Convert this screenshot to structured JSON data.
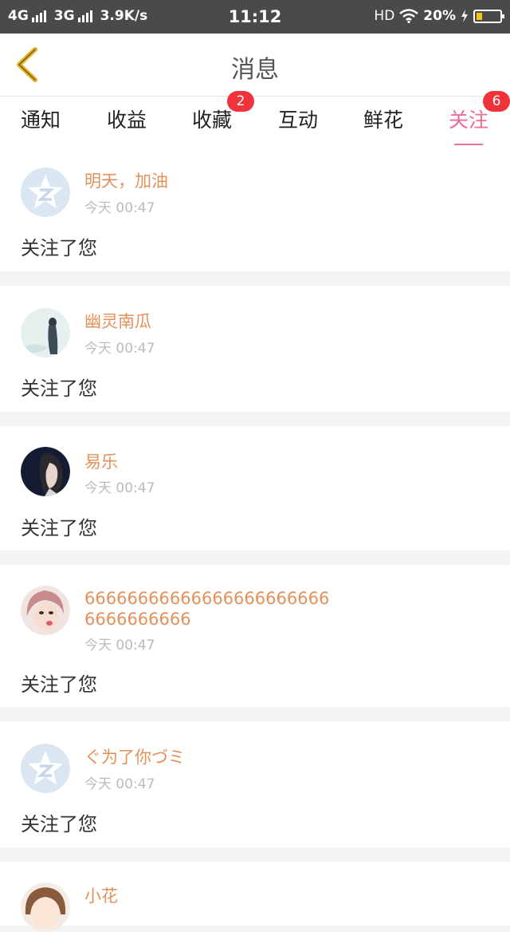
{
  "status_bar": {
    "network1": "4G",
    "network2": "3G",
    "speed": "3.9K/s",
    "time": "11:12",
    "hd": "HD",
    "battery": "20%"
  },
  "header": {
    "title": "消息"
  },
  "tabs": [
    {
      "label": "通知"
    },
    {
      "label": "收益"
    },
    {
      "label": "收藏",
      "badge": "2"
    },
    {
      "label": "互动"
    },
    {
      "label": "鲜花"
    },
    {
      "label": "关注",
      "badge": "6",
      "active": true
    }
  ],
  "items": [
    {
      "name": "明天，加油",
      "time": "今天 00:47",
      "content": "关注了您",
      "avatar": "default-avatar"
    },
    {
      "name": "幽灵南瓜",
      "time": "今天 00:47",
      "content": "关注了您",
      "avatar": "photo-avatar-pale"
    },
    {
      "name": "易乐",
      "time": "今天 00:47",
      "content": "关注了您",
      "avatar": "photo-avatar-dark"
    },
    {
      "name": "666666666666666666666666666666666",
      "time": "今天 00:47",
      "content": "关注了您",
      "avatar": "photo-avatar-girl"
    },
    {
      "name": "ぐ为了你づミ",
      "time": "今天 00:47",
      "content": "关注了您",
      "avatar": "default-avatar"
    },
    {
      "name": "小花",
      "time": "",
      "content": "",
      "avatar": "photo-avatar-cartoon"
    }
  ],
  "colors": {
    "accent": "#ec6d8f",
    "name": "#e3915a",
    "badge": "#f0333a",
    "back_arrow": "#e7b21a"
  }
}
